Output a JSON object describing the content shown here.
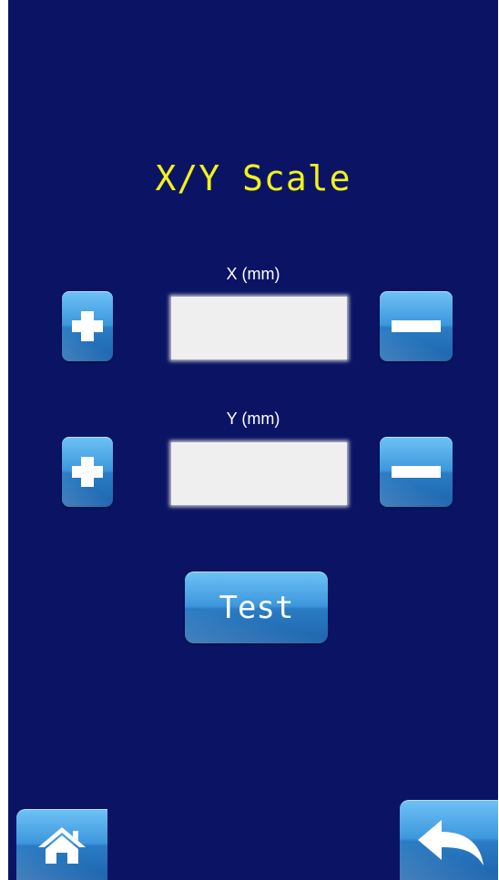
{
  "page": {
    "title": "X/Y Scale"
  },
  "x_axis": {
    "label": "X (mm)",
    "value": "",
    "increase_icon": "plus-icon",
    "decrease_icon": "minus-icon"
  },
  "y_axis": {
    "label": "Y (mm)",
    "value": "",
    "increase_icon": "plus-icon",
    "decrease_icon": "minus-icon"
  },
  "actions": {
    "test_label": "Test"
  },
  "nav": {
    "home_icon": "home-icon",
    "back_icon": "back-arrow-icon"
  },
  "colors": {
    "background": "#0b1464",
    "title": "#f2f21c",
    "button": "#3d97dc"
  }
}
